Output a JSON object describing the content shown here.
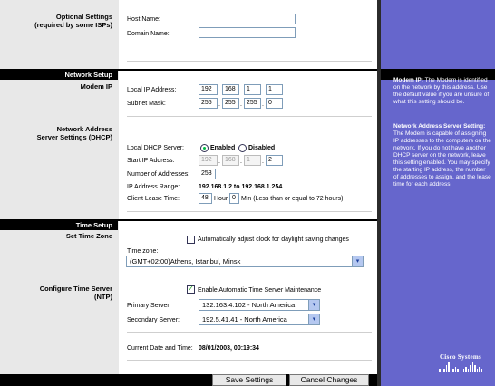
{
  "left": {
    "optional_settings": "Optional Settings",
    "optional_settings_sub": "(required by some ISPs)",
    "network_setup": "Network Setup",
    "modem_ip": "Modem IP",
    "nas_1": "Network Address",
    "nas_2": "Server Settings (DHCP)",
    "time_setup": "Time Setup",
    "set_time_zone": "Set Time Zone",
    "cts_1": "Configure Time Server",
    "cts_2": "(NTP)"
  },
  "optional": {
    "host_name_label": "Host Name:",
    "host_name_value": "",
    "domain_name_label": "Domain Name:",
    "domain_name_value": ""
  },
  "modem": {
    "local_ip_label": "Local IP Address:",
    "local_ip": [
      "192",
      "168",
      "1",
      "1"
    ],
    "subnet_label": "Subnet Mask:",
    "subnet": [
      "255",
      "255",
      "255",
      "0"
    ]
  },
  "dhcp": {
    "server_label": "Local DHCP Server:",
    "enabled_label": "Enabled",
    "disabled_label": "Disabled",
    "start_ip_label": "Start IP Address:",
    "start_ip": [
      "192",
      "168",
      "1",
      "2"
    ],
    "num_label": "Number of Addresses:",
    "num_value": "253",
    "range_label": "IP Address Range:",
    "range_value": "192.168.1.2   to   192.168.1.254",
    "lease_label": "Client Lease Time:",
    "lease_hours": "48",
    "hour_label": "Hour",
    "lease_min": "0",
    "min_label": "Min (Less than or equal to 72 hours)"
  },
  "timezone": {
    "auto_dst_label": "Automatically adjust clock for daylight saving changes",
    "tz_label": "Time zone:",
    "tz_value": "(GMT+02:00)Athens, Istanbul, Minsk"
  },
  "ntp": {
    "enable_label": "Enable Automatic Time Server Maintenance",
    "primary_label": "Primary Server:",
    "primary_value": "132.163.4.102 - North America",
    "secondary_label": "Secondary Server:",
    "secondary_value": "192.5.41.41 - North America",
    "current_label": "Current Date and Time:",
    "current_value": "08/01/2003, 00:19:34"
  },
  "help": {
    "modem_title": "Modem IP:",
    "modem_text": " The Modem is identified on the network by this address. Use the default value if you are unsure of what this setting should be.",
    "nas_title": "Network Address Server Setting:",
    "nas_text": " The Modem is capable of assigning IP addresses to the computers on the network. If you do not have another DHCP server on the network, leave this setting enabled. You may specify the starting IP address, the number of addresses to assign, and the lease time for each address."
  },
  "buttons": {
    "save": "Save Settings",
    "cancel": "Cancel Changes"
  },
  "logo": {
    "text": "Cisco Systems"
  },
  "colors": {
    "left_panel": "#e8e8e8",
    "right_panel": "#6666cc",
    "section_bar": "#000000"
  }
}
